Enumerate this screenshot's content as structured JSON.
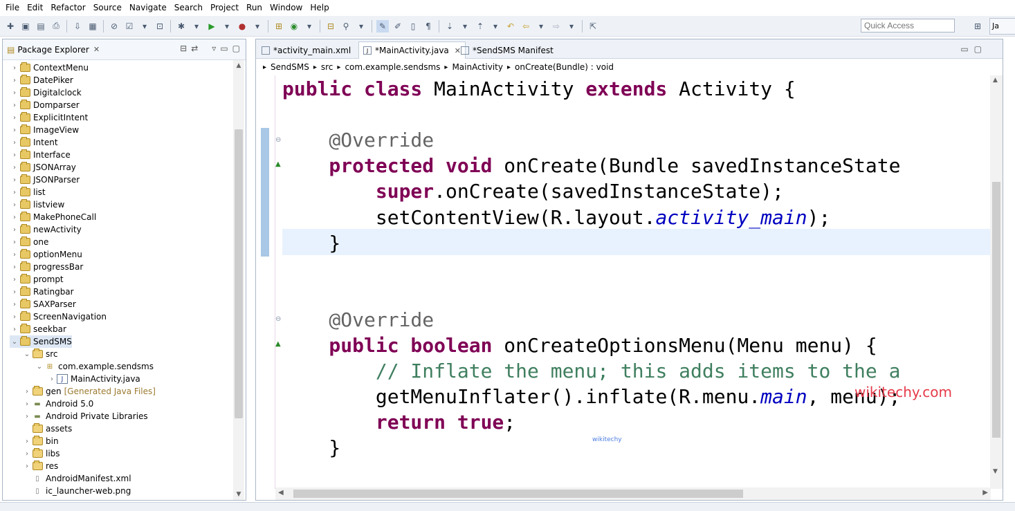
{
  "menu": [
    "File",
    "Edit",
    "Refactor",
    "Source",
    "Navigate",
    "Search",
    "Project",
    "Run",
    "Window",
    "Help"
  ],
  "quick_access": {
    "placeholder": "Quick Access"
  },
  "perspective_label": "Ja",
  "package_explorer": {
    "title": "Package Explorer",
    "items": [
      {
        "label": "ContextMenu",
        "level": 0,
        "type": "project",
        "expanded": false
      },
      {
        "label": "DatePiker",
        "level": 0,
        "type": "project",
        "expanded": false
      },
      {
        "label": "Digitalclock",
        "level": 0,
        "type": "project",
        "expanded": false
      },
      {
        "label": "Domparser",
        "level": 0,
        "type": "project",
        "expanded": false
      },
      {
        "label": "ExplicitIntent",
        "level": 0,
        "type": "project",
        "expanded": false
      },
      {
        "label": "ImageView",
        "level": 0,
        "type": "project",
        "expanded": false
      },
      {
        "label": "Intent",
        "level": 0,
        "type": "project",
        "expanded": false
      },
      {
        "label": "Interface",
        "level": 0,
        "type": "project",
        "expanded": false
      },
      {
        "label": "JSONArray",
        "level": 0,
        "type": "project",
        "expanded": false
      },
      {
        "label": "JSONParser",
        "level": 0,
        "type": "project",
        "expanded": false
      },
      {
        "label": "list",
        "level": 0,
        "type": "project",
        "expanded": false
      },
      {
        "label": "listview",
        "level": 0,
        "type": "project",
        "expanded": false
      },
      {
        "label": "MakePhoneCall",
        "level": 0,
        "type": "project",
        "expanded": false
      },
      {
        "label": "newActivity",
        "level": 0,
        "type": "project",
        "expanded": false
      },
      {
        "label": "one",
        "level": 0,
        "type": "project",
        "expanded": false
      },
      {
        "label": "optionMenu",
        "level": 0,
        "type": "project",
        "expanded": false
      },
      {
        "label": "progressBar",
        "level": 0,
        "type": "project",
        "expanded": false
      },
      {
        "label": "prompt",
        "level": 0,
        "type": "project",
        "expanded": false
      },
      {
        "label": "Ratingbar",
        "level": 0,
        "type": "project",
        "expanded": false
      },
      {
        "label": "SAXParser",
        "level": 0,
        "type": "project",
        "expanded": false
      },
      {
        "label": "ScreenNavigation",
        "level": 0,
        "type": "project",
        "expanded": false
      },
      {
        "label": "seekbar",
        "level": 0,
        "type": "project",
        "expanded": false
      },
      {
        "label": "SendSMS",
        "level": 0,
        "type": "project",
        "expanded": true,
        "selected": true
      },
      {
        "label": "src",
        "level": 1,
        "type": "folder",
        "expanded": true
      },
      {
        "label": "com.example.sendsms",
        "level": 2,
        "type": "package",
        "expanded": true
      },
      {
        "label": "MainActivity.java",
        "level": 3,
        "type": "java",
        "expanded": false
      },
      {
        "label": "gen",
        "suffix": "[Generated Java Files]",
        "level": 1,
        "type": "folder",
        "expanded": false
      },
      {
        "label": "Android 5.0",
        "level": 1,
        "type": "lib",
        "expanded": false
      },
      {
        "label": "Android Private Libraries",
        "level": 1,
        "type": "lib",
        "expanded": false
      },
      {
        "label": "assets",
        "level": 1,
        "type": "folder",
        "expanded": null
      },
      {
        "label": "bin",
        "level": 1,
        "type": "folder",
        "expanded": false
      },
      {
        "label": "libs",
        "level": 1,
        "type": "folder",
        "expanded": false
      },
      {
        "label": "res",
        "level": 1,
        "type": "folder",
        "expanded": false
      },
      {
        "label": "AndroidManifest.xml",
        "level": 1,
        "type": "file",
        "expanded": null
      },
      {
        "label": "ic_launcher-web.png",
        "level": 1,
        "type": "file",
        "expanded": null
      }
    ]
  },
  "editor": {
    "tabs": [
      {
        "label": "*activity_main.xml",
        "active": false
      },
      {
        "label": "*MainActivity.java",
        "active": true
      },
      {
        "label": "*SendSMS Manifest",
        "active": false
      }
    ],
    "breadcrumb": [
      "SendSMS",
      "src",
      "com.example.sendsms",
      "MainActivity",
      "onCreate(Bundle) : void"
    ],
    "code_lines": [
      [
        [
          "kw",
          "public class "
        ],
        [
          "",
          "MainActivity "
        ],
        [
          "kw",
          "extends "
        ],
        [
          "",
          "Activity {"
        ]
      ],
      [],
      [
        [
          "ann",
          "    @Override"
        ]
      ],
      [
        [
          "kw",
          "    protected void "
        ],
        [
          "",
          "onCreate(Bundle savedInstanceState"
        ]
      ],
      [
        [
          "kw",
          "        super"
        ],
        [
          "",
          ".onCreate(savedInstanceState);"
        ]
      ],
      [
        [
          "",
          "        setContentView(R.layout."
        ],
        [
          "ital",
          "activity_main"
        ],
        [
          "",
          ");"
        ]
      ],
      [
        [
          "",
          "    }"
        ]
      ],
      [],
      [],
      [
        [
          "ann",
          "    @Override"
        ]
      ],
      [
        [
          "kw",
          "    public boolean "
        ],
        [
          "",
          "onCreateOptionsMenu(Menu menu) {"
        ]
      ],
      [
        [
          "cmt",
          "        // Inflate the menu; this adds items to the a"
        ]
      ],
      [
        [
          "",
          "        getMenuInflater().inflate(R.menu."
        ],
        [
          "ital",
          "main"
        ],
        [
          "",
          ", menu);"
        ]
      ],
      [
        [
          "kw",
          "        return true"
        ],
        [
          "",
          ";"
        ]
      ],
      [
        [
          "",
          "    }"
        ]
      ]
    ]
  },
  "watermark": "wikitechy.com",
  "watermark_small": "wikitechy"
}
